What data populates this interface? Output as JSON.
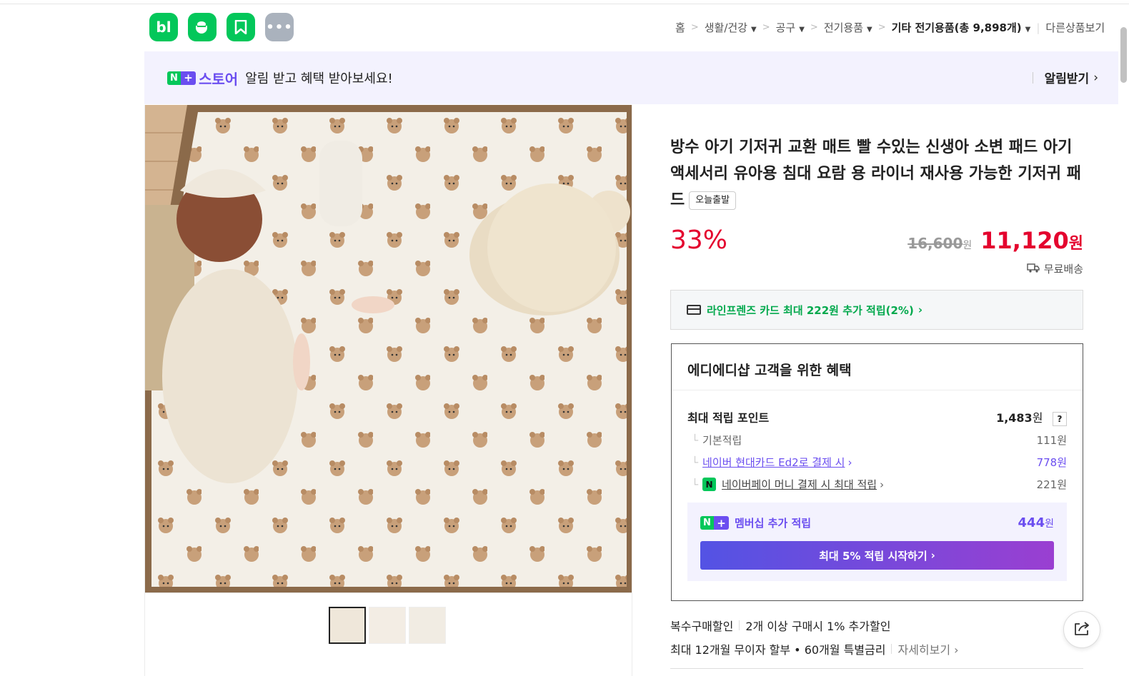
{
  "header": {
    "apps": [
      {
        "name": "blog",
        "glyph": "bl"
      },
      {
        "name": "cafe",
        "glyph": "☕"
      },
      {
        "name": "pay",
        "glyph": "◤"
      },
      {
        "name": "more",
        "glyph": "•••"
      }
    ]
  },
  "breadcrumb": {
    "home": "홈",
    "level1": "생활/건강",
    "level2": "공구",
    "level3": "전기용품",
    "current": "기타 전기용품",
    "count": "(총 9,898개)",
    "other": "다른상품보기"
  },
  "store_banner": {
    "n_badge": "N",
    "plus_badge": "+",
    "store_name": "스토어",
    "message": "알림 받고 혜택 받아보세요!",
    "action": "알림받기"
  },
  "product": {
    "title": "방수 아기 기저귀 교환 매트 빨 수있는 신생아 소변 패드 아기 액세서리 유아용 침대 요람 용 라이너 재사용 가능한 기저귀 패드",
    "tag": "오늘출발",
    "discount": "33%",
    "original_price": "16,600",
    "original_unit": "원",
    "final_price": "11,120",
    "final_unit": "원",
    "shipping": "무료배송"
  },
  "card_offer": {
    "text": "라인프렌즈 카드 최대 222원 추가 적립(2%)"
  },
  "benefit": {
    "title": "에디에디샵 고객을 위한 혜택",
    "max_points_label": "최대 적립 포인트",
    "max_points_value": "1,483",
    "max_points_unit": "원",
    "help": "?",
    "rows": [
      {
        "label": "기본적립",
        "value": "111원"
      },
      {
        "label": "네이버 현대카드 Ed2로 결제 시",
        "value": "778원"
      },
      {
        "label": "네이버페이 머니 결제 시 최대 적립",
        "value": "221원"
      }
    ],
    "membership_label": "멤버십 추가 적립",
    "membership_value": "444",
    "membership_unit": "원",
    "membership_button": "최대 5% 적립 시작하기"
  },
  "extras": {
    "bulk_label": "복수구매할인",
    "bulk_text": "2개 이상 구매시 1% 추가할인",
    "install_text": "최대 12개월 무이자 할부 • 60개월 특별금리",
    "install_more": "자세히보기"
  },
  "colors": {
    "naver_green": "#03c75a",
    "store_purple": "#6b4ef0",
    "sale_red": "#e4032e"
  }
}
